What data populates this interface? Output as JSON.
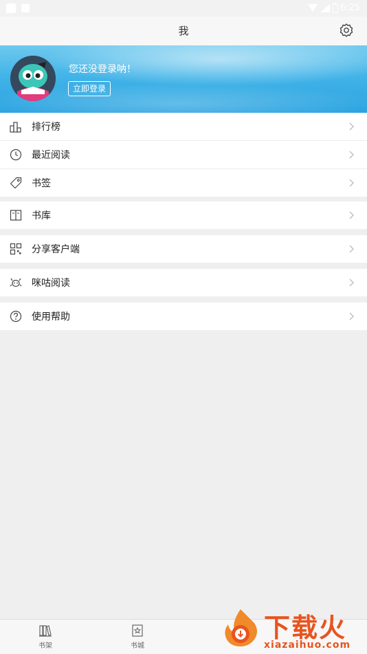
{
  "status_bar": {
    "time": "6:25"
  },
  "nav": {
    "title": "我",
    "settings_icon": "gear-icon"
  },
  "profile": {
    "hint": "您还没登录呐！",
    "login_label": "立即登录",
    "avatar_icon": "mascot-avatar"
  },
  "menu": {
    "group1": [
      {
        "label": "排行榜",
        "icon": "ranking-icon"
      },
      {
        "label": "最近阅读",
        "icon": "clock-icon"
      },
      {
        "label": "书签",
        "icon": "tag-icon"
      }
    ],
    "group2": [
      {
        "label": "书库",
        "icon": "book-icon"
      }
    ],
    "group3": [
      {
        "label": "分享客户端",
        "icon": "qr-icon"
      }
    ],
    "group4": [
      {
        "label": "咪咕阅读",
        "icon": "migu-icon"
      }
    ],
    "group5": [
      {
        "label": "使用帮助",
        "icon": "help-icon"
      }
    ]
  },
  "tabs": [
    {
      "label": "书架",
      "icon": "bookshelf-icon"
    },
    {
      "label": "书城",
      "icon": "bookstore-icon"
    }
  ],
  "watermark": {
    "brand": "下载火",
    "url": "xiazaihuo.com"
  },
  "colors": {
    "header": "#42b4e8",
    "accent": "#e8541e"
  }
}
